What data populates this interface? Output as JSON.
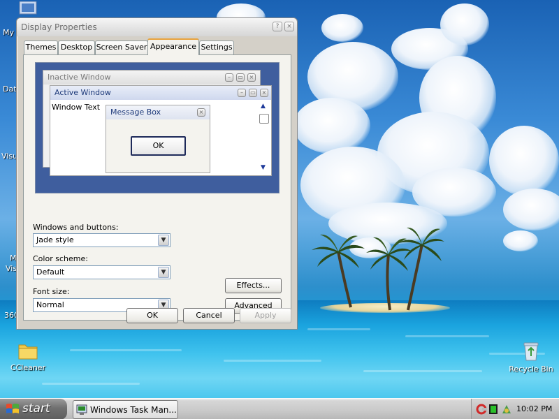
{
  "desktop": {
    "icons": {
      "ccleaner": "CCleaner",
      "recycle_bin": "Recycle Bin"
    },
    "cut_labels": [
      "My",
      "Dat",
      "Visu",
      "M",
      "Visu",
      "360"
    ]
  },
  "window": {
    "title": "Display Properties",
    "title_buttons": [
      "?",
      "×"
    ],
    "tabs": [
      {
        "label": "Themes",
        "active": false
      },
      {
        "label": "Desktop",
        "active": false
      },
      {
        "label": "Screen Saver",
        "active": false
      },
      {
        "label": "Appearance",
        "active": true
      },
      {
        "label": "Settings",
        "active": false
      }
    ],
    "preview": {
      "inactive_title": "Inactive Window",
      "active_title": "Active Window",
      "window_text": "Window Text",
      "message_title": "Message Box",
      "ok_label": "OK"
    },
    "windows_buttons": {
      "label": "Windows and buttons:",
      "value": "Jade style"
    },
    "color_scheme": {
      "label": "Color scheme:",
      "value": "Default"
    },
    "font_size": {
      "label": "Font size:",
      "value": "Normal"
    },
    "effects_label": "Effects...",
    "advanced_label": "Advanced",
    "ok_label": "OK",
    "cancel_label": "Cancel",
    "apply_label": "Apply"
  },
  "taskbar": {
    "start_label": "start",
    "task_label": "Windows Task Man...",
    "clock": "10:02 PM"
  },
  "colors": {
    "accent_tab": "#e8a23c",
    "active_title_bg": "#dbe3f4",
    "preview_bg": "#3f5e9e"
  }
}
